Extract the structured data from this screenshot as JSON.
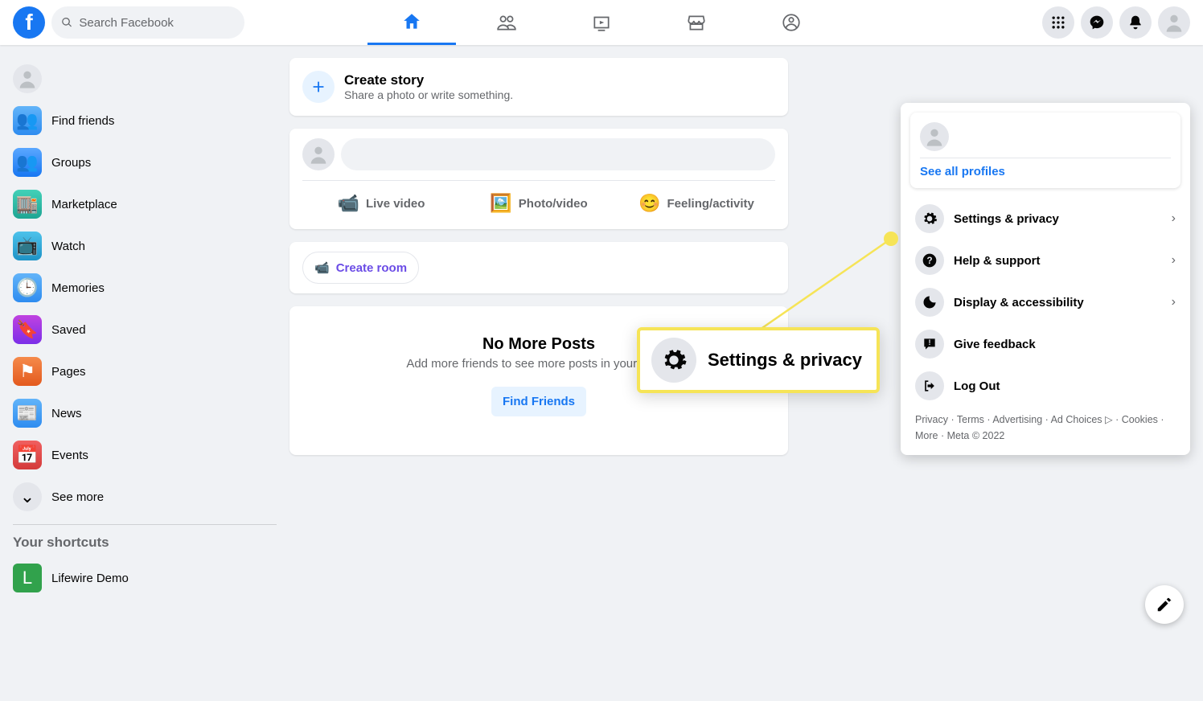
{
  "search": {
    "placeholder": "Search Facebook"
  },
  "leftRail": {
    "items": [
      {
        "label": "Find friends",
        "icon": "👥",
        "cls": "bg-sky"
      },
      {
        "label": "Groups",
        "icon": "👥",
        "cls": "bg-blue"
      },
      {
        "label": "Marketplace",
        "icon": "🏬",
        "cls": "bg-teal"
      },
      {
        "label": "Watch",
        "icon": "📺",
        "cls": "bg-cyan"
      },
      {
        "label": "Memories",
        "icon": "🕒",
        "cls": "bg-sky"
      },
      {
        "label": "Saved",
        "icon": "🔖",
        "cls": "bg-purp"
      },
      {
        "label": "Pages",
        "icon": "⚑",
        "cls": "bg-orange"
      },
      {
        "label": "News",
        "icon": "📰",
        "cls": "bg-sky"
      },
      {
        "label": "Events",
        "icon": "📅",
        "cls": "bg-red"
      }
    ],
    "seeMore": "See more",
    "shortcutsHeading": "Your shortcuts",
    "shortcut": {
      "label": "Lifewire Demo",
      "initial": "L"
    }
  },
  "story": {
    "title": "Create story",
    "sub": "Share a photo or write something."
  },
  "composer": {
    "liveVideo": "Live video",
    "photoVideo": "Photo/video",
    "feeling": "Feeling/activity"
  },
  "rooms": {
    "createRoom": "Create room"
  },
  "noMore": {
    "title": "No More Posts",
    "sub": "Add more friends to see more posts in your Feed.",
    "cta": "Find Friends"
  },
  "dropdown": {
    "seeAll": "See all profiles",
    "items": [
      {
        "label": "Settings & privacy",
        "icon": "gear",
        "chev": true
      },
      {
        "label": "Help & support",
        "icon": "help",
        "chev": true
      },
      {
        "label": "Display & accessibility",
        "icon": "moon",
        "chev": true
      },
      {
        "label": "Give feedback",
        "icon": "feedback",
        "chev": false
      },
      {
        "label": "Log Out",
        "icon": "logout",
        "chev": false
      }
    ],
    "footer": {
      "privacy": "Privacy",
      "terms": "Terms",
      "advertising": "Advertising",
      "adChoices": "Ad Choices",
      "cookies": "Cookies",
      "more": "More",
      "meta": "Meta © 2022"
    }
  },
  "callout": {
    "label": "Settings & privacy"
  }
}
